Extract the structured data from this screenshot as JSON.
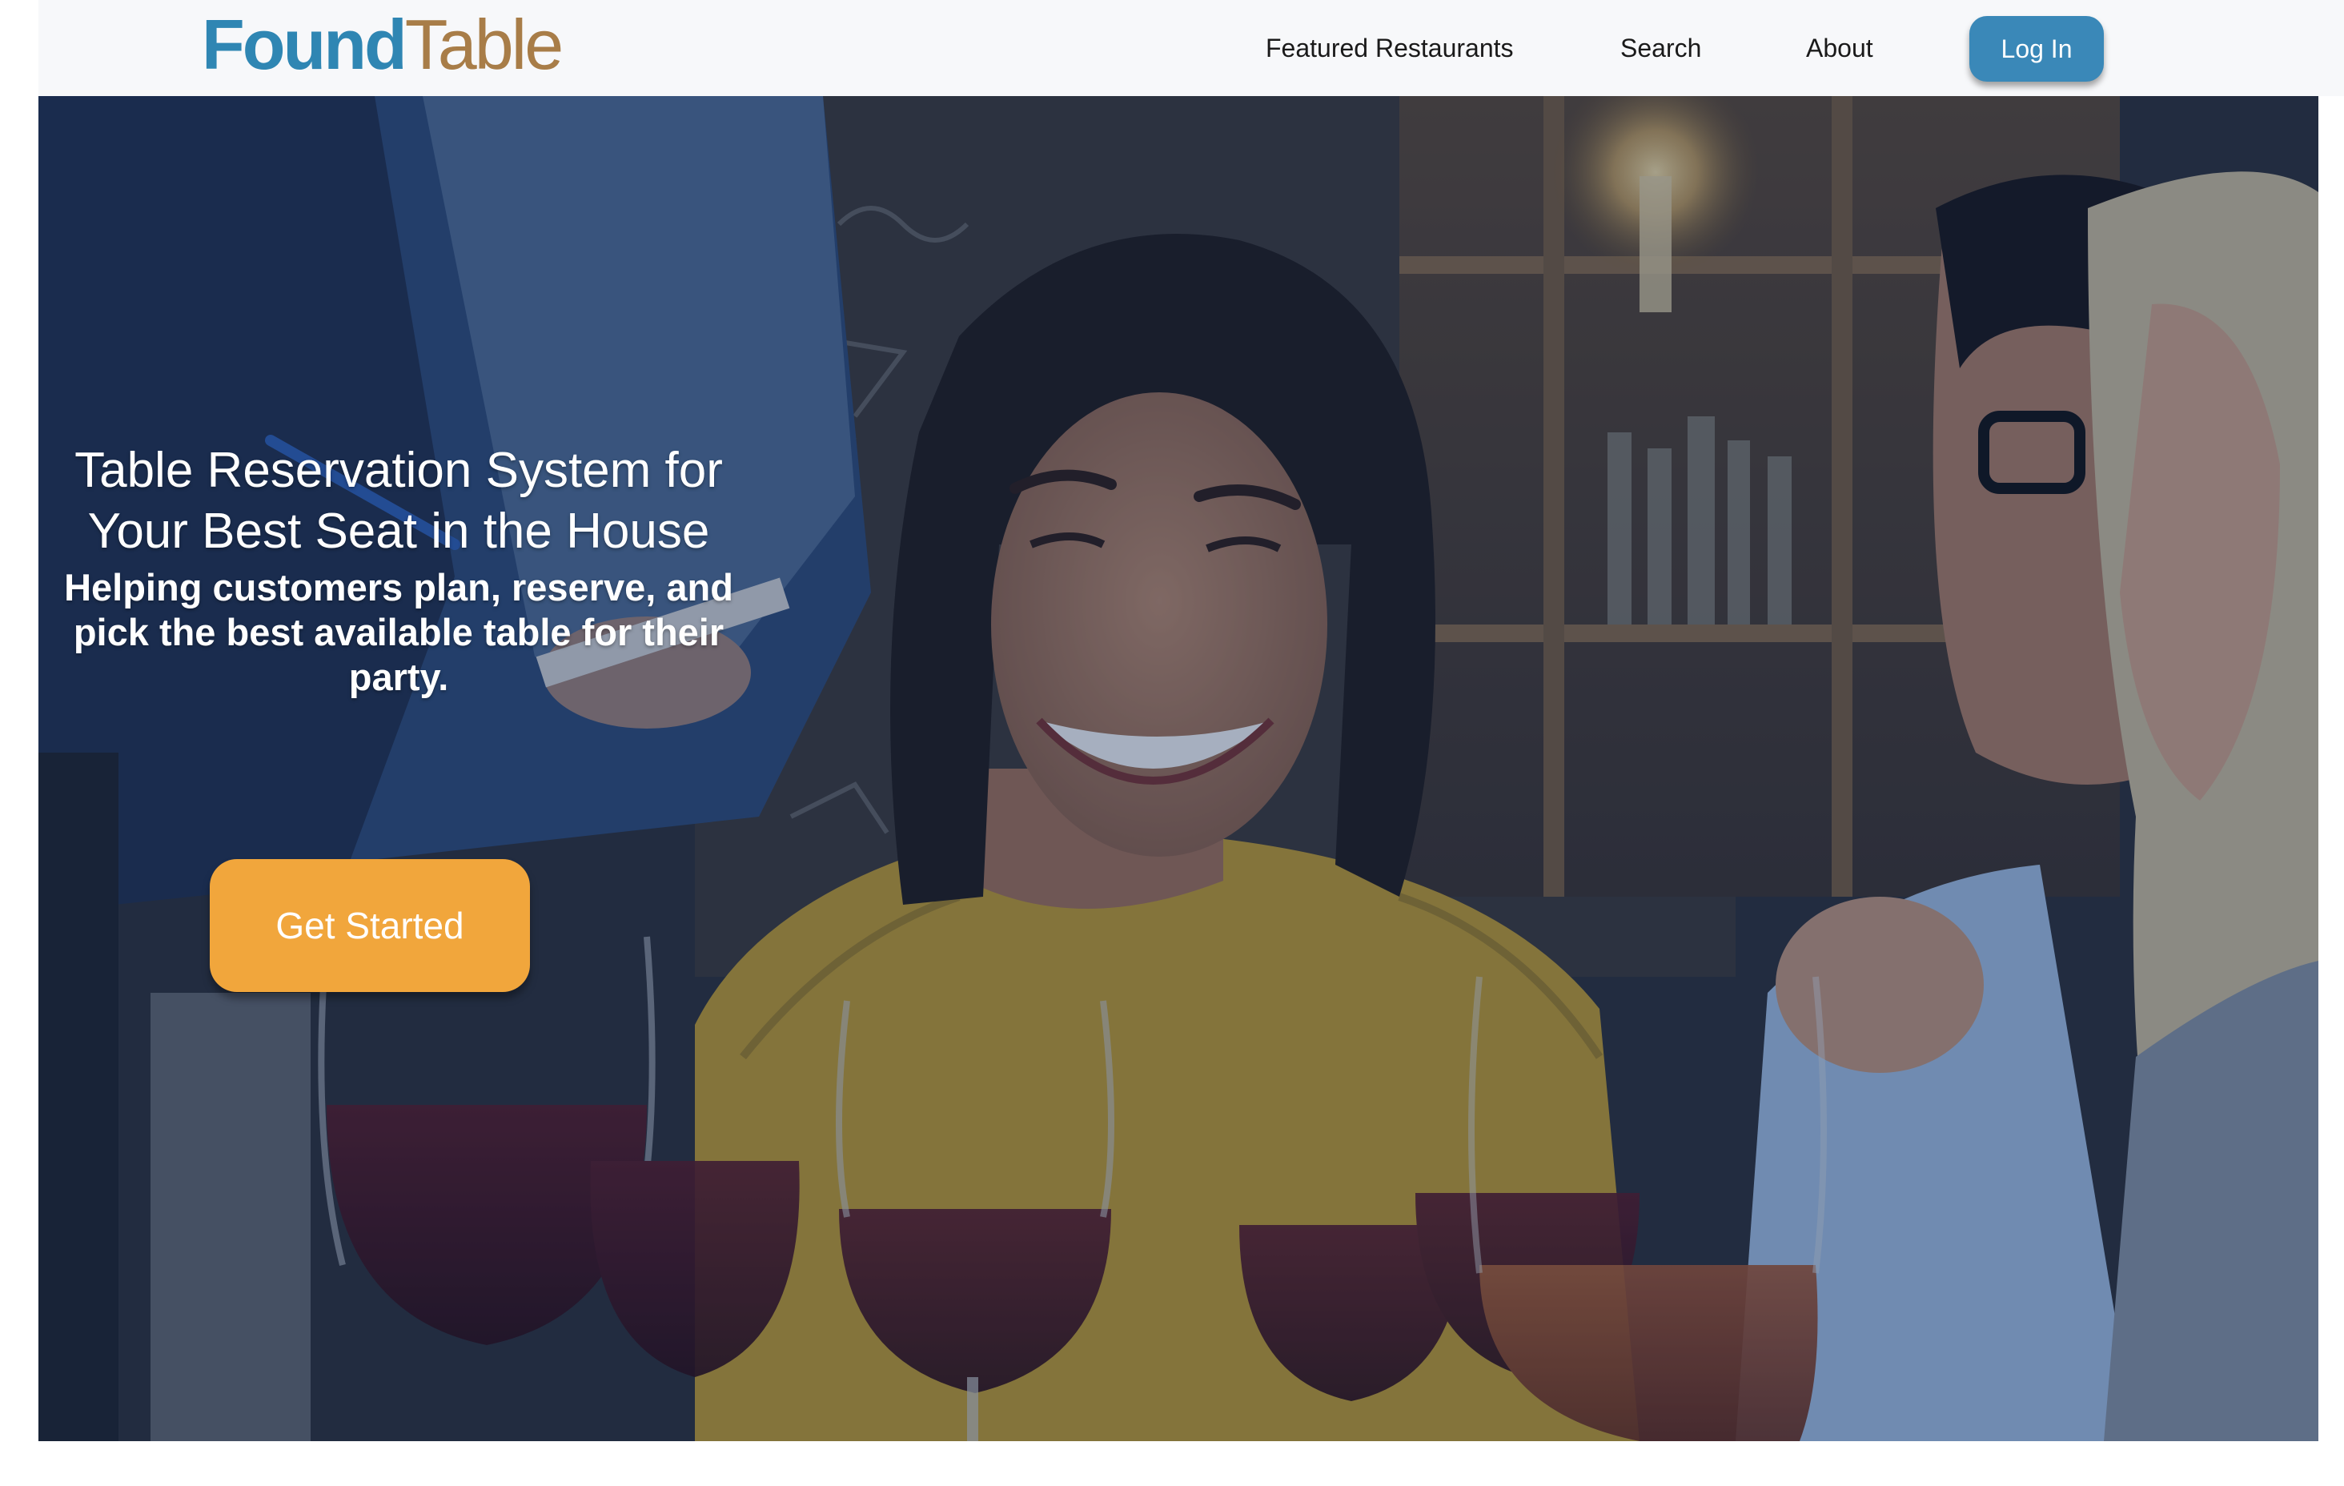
{
  "brand": {
    "name_part1": "Found",
    "name_part2": "Table",
    "color_primary": "#2f86b3",
    "color_secondary": "#a87d48"
  },
  "nav": {
    "links": [
      {
        "label": "Featured Restaurants"
      },
      {
        "label": "Search"
      },
      {
        "label": "About"
      }
    ],
    "login_label": "Log In",
    "login_color": "#3a88b8"
  },
  "hero": {
    "title": "Table Reservation System for Your Best Seat in the House",
    "subtitle": "Helping customers plan, reserve, and pick the best available table for their party.",
    "cta_label": "Get Started",
    "cta_color": "#f1a63c",
    "image_subject": "photo-diners-laughing-with-wine-glasses"
  }
}
